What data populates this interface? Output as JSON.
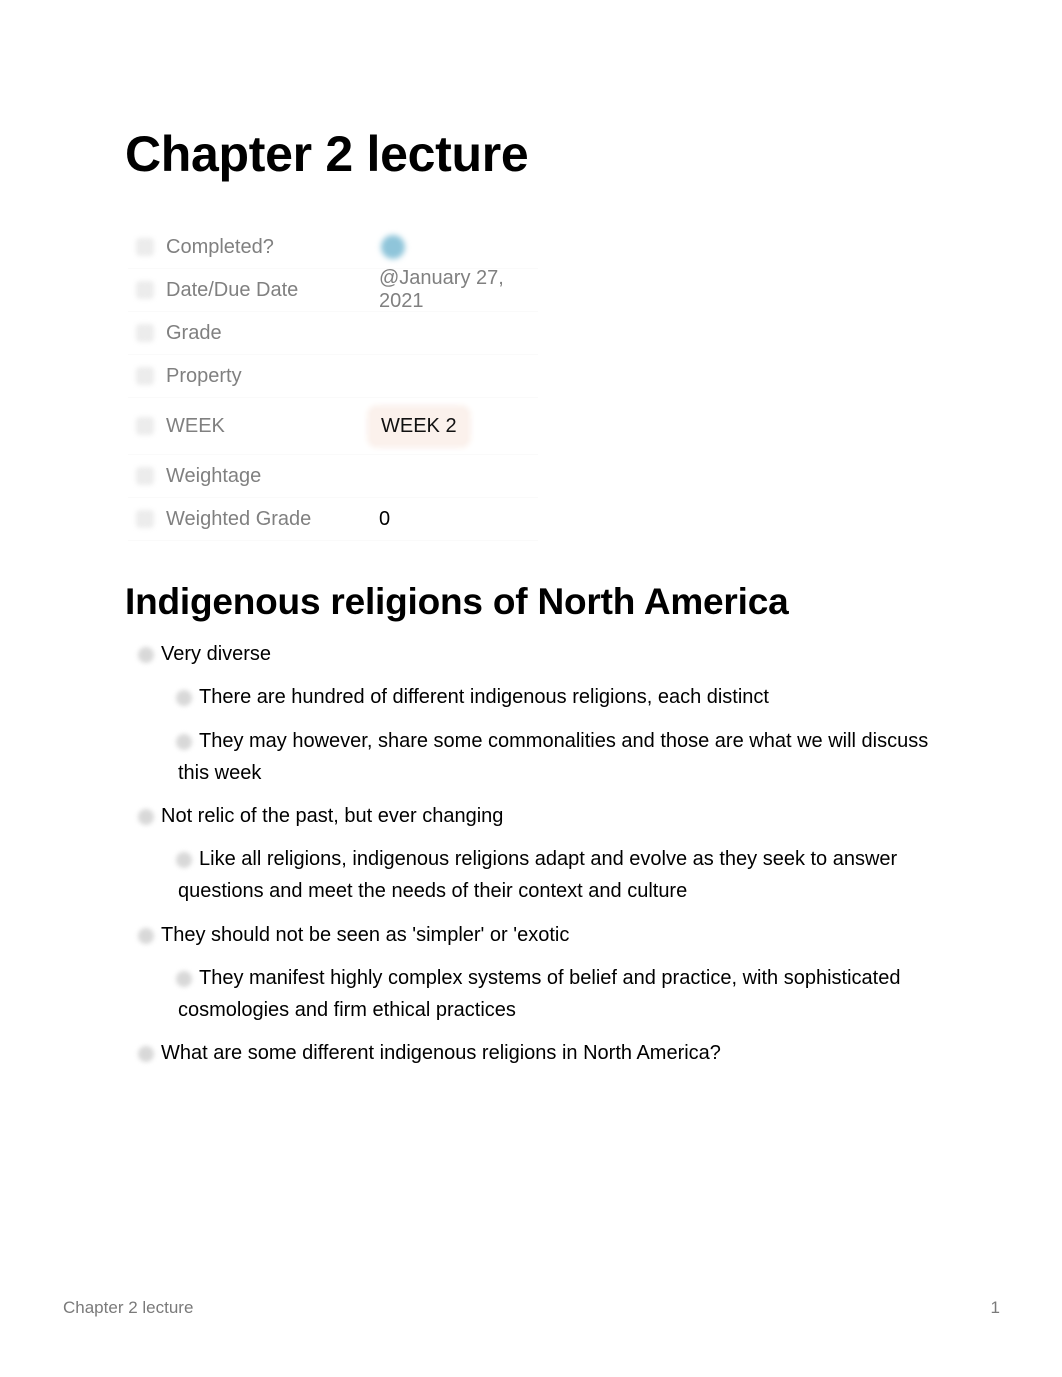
{
  "page": {
    "title": "Chapter 2 lecture"
  },
  "properties": [
    {
      "name": "Completed?",
      "icon": "checkbox-property-icon",
      "value_type": "checkbox",
      "checked": false,
      "value": ""
    },
    {
      "name": "Date/Due Date",
      "icon": "calendar-property-icon",
      "value_type": "date",
      "value": "@January 27, 2021"
    },
    {
      "name": "Grade",
      "icon": "number-property-icon",
      "value_type": "number",
      "value": ""
    },
    {
      "name": "Property",
      "icon": "text-property-icon",
      "value_type": "text",
      "value": ""
    },
    {
      "name": "WEEK",
      "icon": "select-property-icon",
      "value_type": "select",
      "value": "WEEK 2",
      "tag_color": "#fbf1ec"
    },
    {
      "name": "Weightage",
      "icon": "number-property-icon",
      "value_type": "number",
      "value": ""
    },
    {
      "name": "Weighted Grade",
      "icon": "formula-property-icon",
      "value_type": "formula",
      "value": "0"
    }
  ],
  "section": {
    "heading": "Indigenous religions of North America",
    "bullets": [
      {
        "level": 1,
        "text": "Very diverse"
      },
      {
        "level": 2,
        "text": "There are hundred of different indigenous religions, each distinct"
      },
      {
        "level": 2,
        "text": "They may however, share some commonalities and those are what we will discuss this week"
      },
      {
        "level": 1,
        "text": "Not relic of the past, but ever changing"
      },
      {
        "level": 2,
        "text": "Like all religions, indigenous religions adapt and evolve as they seek to answer questions and meet the needs of their context and culture"
      },
      {
        "level": 1,
        "text": "They should not be seen as 'simpler' or 'exotic"
      },
      {
        "level": 2,
        "text": "They manifest highly complex systems of belief and practice, with sophisticated cosmologies and firm ethical practices"
      },
      {
        "level": 1,
        "text": "What are some different indigenous religions in North America?"
      }
    ]
  },
  "footer": {
    "title": "Chapter 2 lecture",
    "page_number": "1"
  },
  "colors": {
    "checkbox_fill": "#8fc5da",
    "week_tag_bg": "#fbf1ec",
    "property_label": "#808080",
    "footer_text": "#7a7a7a"
  }
}
